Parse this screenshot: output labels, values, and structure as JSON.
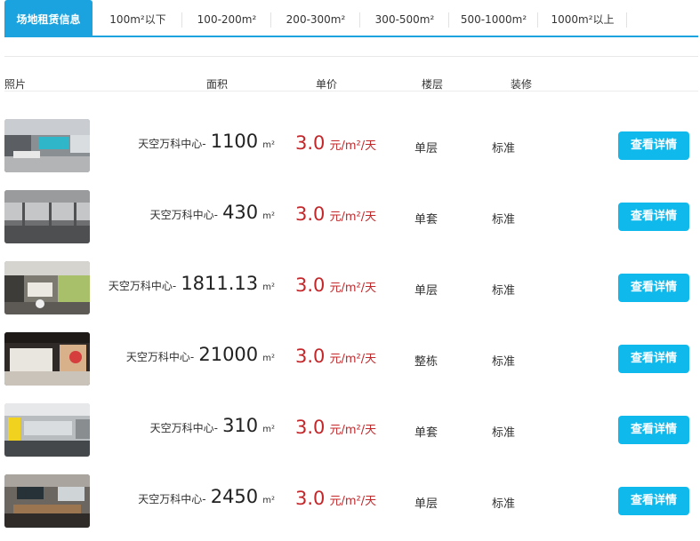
{
  "tabs": [
    {
      "label": "场地租赁信息",
      "active": true
    },
    {
      "label": "100m²以下"
    },
    {
      "label": "100-200m²"
    },
    {
      "label": "200-300m²"
    },
    {
      "label": "300-500m²"
    },
    {
      "label": "500-1000m²"
    },
    {
      "label": "1000m²以上"
    }
  ],
  "table": {
    "headers": {
      "photo": "照片",
      "area": "面积",
      "price": "单价",
      "floor": "楼层",
      "decoration": "装修"
    },
    "rows": [
      {
        "building": "天空万科中心-",
        "area": "1100",
        "area_unit": "m²",
        "price": "3.0",
        "price_unit": "元/m²/天",
        "floor": "单层",
        "decoration": "标准",
        "button": "查看详情"
      },
      {
        "building": "天空万科中心-",
        "area": "430",
        "area_unit": "m²",
        "price": "3.0",
        "price_unit": "元/m²/天",
        "floor": "单套",
        "decoration": "标准",
        "button": "查看详情"
      },
      {
        "building": "天空万科中心-",
        "area": "1811.13",
        "area_unit": "m²",
        "price": "3.0",
        "price_unit": "元/m²/天",
        "floor": "单层",
        "decoration": "标准",
        "button": "查看详情"
      },
      {
        "building": "天空万科中心-",
        "area": "21000",
        "area_unit": "m²",
        "price": "3.0",
        "price_unit": "元/m²/天",
        "floor": "整栋",
        "decoration": "标准",
        "button": "查看详情"
      },
      {
        "building": "天空万科中心-",
        "area": "310",
        "area_unit": "m²",
        "price": "3.0",
        "price_unit": "元/m²/天",
        "floor": "单套",
        "decoration": "标准",
        "button": "查看详情"
      },
      {
        "building": "天空万科中心-",
        "area": "2450",
        "area_unit": "m²",
        "price": "3.0",
        "price_unit": "元/m²/天",
        "floor": "单层",
        "decoration": "标准",
        "button": "查看详情"
      }
    ]
  },
  "colors": {
    "accent": "#1aa3de",
    "button": "#0fb9ec",
    "price": "#c4272a"
  }
}
